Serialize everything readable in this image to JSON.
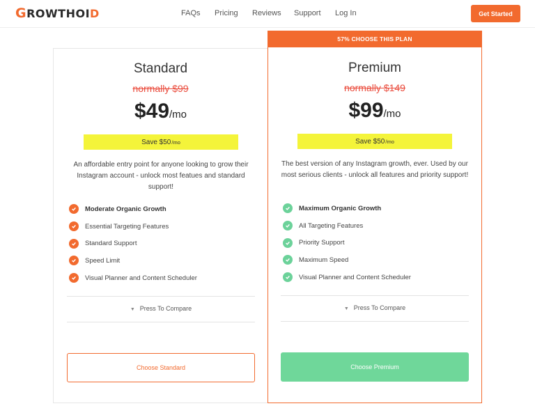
{
  "header": {
    "logo_text": "GROWTHOID",
    "nav": [
      "FAQs",
      "Pricing",
      "Reviews",
      "Support",
      "Log In"
    ],
    "cta_label": "Get Started"
  },
  "colors": {
    "accent": "#f26a2e",
    "green": "#6cd29a",
    "highlight": "#f4f43a",
    "strike": "#ea4b3c"
  },
  "plans": [
    {
      "name": "Standard",
      "old_price": "normally $99",
      "price": "$49",
      "per": "/mo",
      "save": "Save $50",
      "save_per": "/mo",
      "description": "An affordable entry point for anyone looking to grow their Instagram account - unlock most featues and standard support!",
      "features": [
        "Moderate Organic Growth",
        "Essential Targeting Features",
        "Standard Support",
        "Speed Limit",
        "Visual Planner and Content Scheduler"
      ],
      "check_icon": "orange-check-icon",
      "compare_label": "Press To Compare",
      "choose_label": "Choose Standard"
    },
    {
      "banner": "57% CHOOSE THIS PLAN",
      "name": "Premium",
      "old_price": "normally $149",
      "price": "$99",
      "per": "/mo",
      "save": "Save $50",
      "save_per": "/mo",
      "description": "The best version of any Instagram growth, ever. Used by our most serious clients - unlock all features and priority support!",
      "features": [
        "Maximum Organic Growth",
        "All Targeting Features",
        "Priority Support",
        "Maximum Speed",
        "Visual Planner and Content Scheduler"
      ],
      "check_icon": "green-check-icon",
      "compare_label": "Press To Compare",
      "choose_label": "Choose Premium"
    }
  ]
}
